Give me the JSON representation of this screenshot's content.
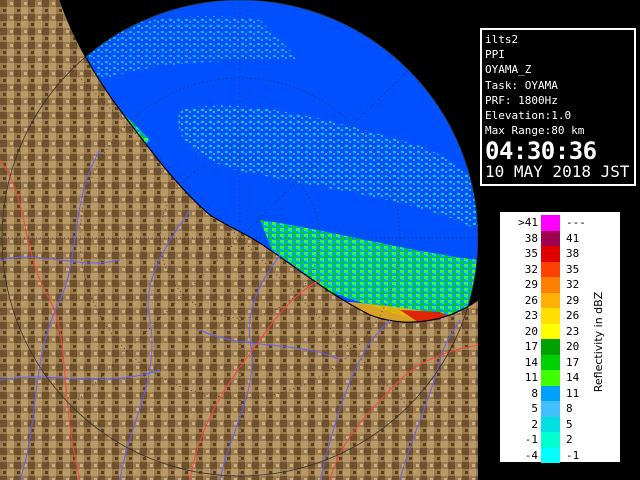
{
  "radar_info": {
    "lines": [
      "ilts2",
      "PPI",
      "OYAMA_Z",
      "Task: OYAMA",
      "PRF: 1800Hz",
      "Elevation:1.0",
      "Max Range:80 km"
    ],
    "time": "04:30:36",
    "date": "10 MAY 2018 JST"
  },
  "scale": {
    "unit_label": "Reflectivity in dBZ",
    "rows": [
      {
        "left": ">41",
        "right": "---",
        "color": "#ff00ff"
      },
      {
        "left": "38",
        "right": "41",
        "color": "#a00050"
      },
      {
        "left": "35",
        "right": "38",
        "color": "#e00000"
      },
      {
        "left": "32",
        "right": "35",
        "color": "#ff4000"
      },
      {
        "left": "29",
        "right": "32",
        "color": "#ff8000"
      },
      {
        "left": "26",
        "right": "29",
        "color": "#ffb000"
      },
      {
        "left": "23",
        "right": "26",
        "color": "#ffe000"
      },
      {
        "left": "20",
        "right": "23",
        "color": "#ffff00"
      },
      {
        "left": "17",
        "right": "20",
        "color": "#00a000"
      },
      {
        "left": "14",
        "right": "17",
        "color": "#00d000"
      },
      {
        "left": "11",
        "right": "14",
        "color": "#40ff00"
      },
      {
        "left": "8",
        "right": "11",
        "color": "#00a0ff"
      },
      {
        "left": "5",
        "right": "8",
        "color": "#40c0ff"
      },
      {
        "left": "2",
        "right": "5",
        "color": "#00e0e0"
      },
      {
        "left": "-1",
        "right": "2",
        "color": "#00ffd0"
      },
      {
        "left": "-4",
        "right": "-1",
        "color": "#00ffff"
      }
    ]
  },
  "colors": {
    "sea_background": "#000000",
    "radar_range": "#0050ff",
    "land": "#8a6a40",
    "rivers": "#6060ff",
    "borders": "#ff4040"
  }
}
